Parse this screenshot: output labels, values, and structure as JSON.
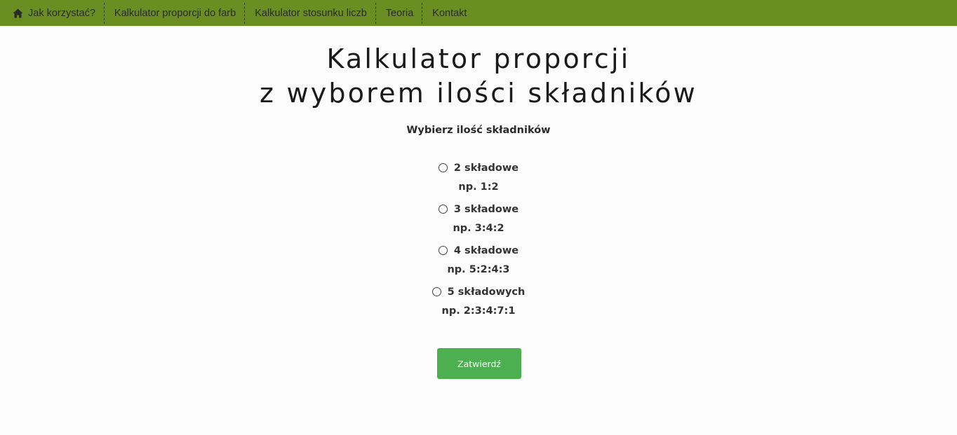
{
  "nav": {
    "items": [
      {
        "label": "Jak korzystać?",
        "icon": "home-icon"
      },
      {
        "label": "Kalkulator proporcji do farb"
      },
      {
        "label": "Kalkulator stosunku liczb"
      },
      {
        "label": "Teoria"
      },
      {
        "label": "Kontakt"
      }
    ],
    "background": "#6b8e23"
  },
  "main": {
    "title_line1": "Kalkulator proporcji",
    "title_line2": "z wyborem ilości składników",
    "subtitle": "Wybierz ilość składników",
    "options": [
      {
        "label": "2 składowe",
        "example": "np. 1:2"
      },
      {
        "label": "3 składowe",
        "example": "np. 3:4:2"
      },
      {
        "label": "4 składowe",
        "example": "np. 5:2:4:3"
      },
      {
        "label": "5 składowych",
        "example": "np. 2:3:4:7:1"
      }
    ],
    "submit_label": "Zatwierdź",
    "submit_color": "#4caf50"
  }
}
